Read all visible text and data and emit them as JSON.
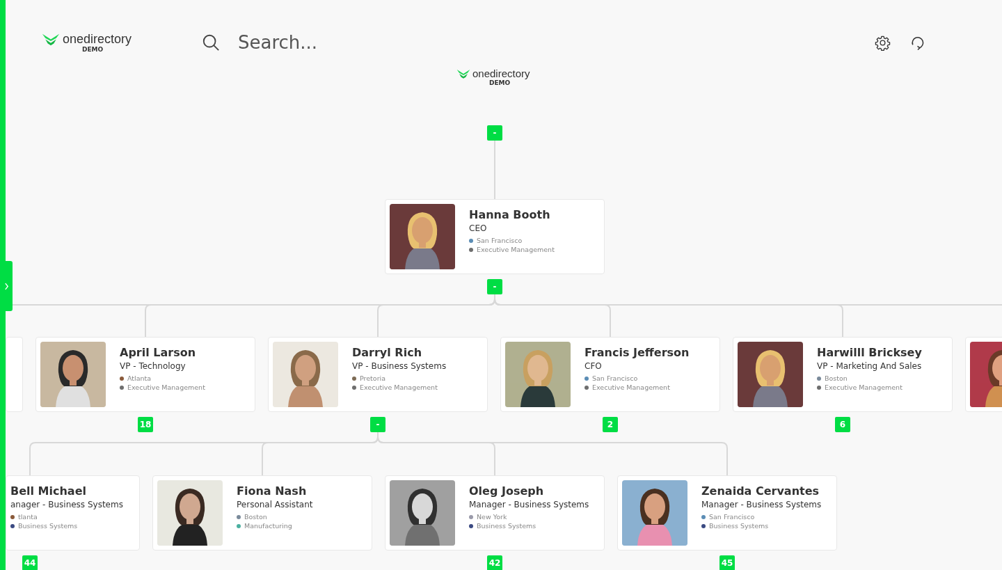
{
  "header": {
    "logo": {
      "name": "onedirectory",
      "tag": "DEMO"
    },
    "search": {
      "placeholder": "Search..."
    }
  },
  "chart_logo": {
    "name": "onedirectory",
    "tag": "DEMO"
  },
  "org_chart": {
    "root": {
      "kind": "full",
      "name": "Hanna Booth",
      "title": "CEO",
      "parent_toggle": "-",
      "toggle": "-",
      "location": {
        "text": "San Francisco",
        "color": "#5b8db5"
      },
      "department": {
        "text": "Executive Management",
        "color": "#6e6e6e"
      },
      "children": [
        {
          "kind": "stub"
        },
        {
          "kind": "full",
          "name": "April Larson",
          "title": "VP - Technology",
          "toggle": "18",
          "location": {
            "text": "Atlanta",
            "color": "#8a5a3a"
          },
          "department": {
            "text": "Executive Management",
            "color": "#6e6e6e"
          }
        },
        {
          "kind": "full",
          "name": "Darryl Rich",
          "title": "VP - Business Systems",
          "toggle": "-",
          "location": {
            "text": "Pretoria",
            "color": "#7d6b55"
          },
          "department": {
            "text": "Executive Management",
            "color": "#6e6e6e"
          },
          "children": [
            {
              "kind": "full",
              "name": "Bell Michael",
              "title": "anager - Business Systems",
              "toggle": "44",
              "location": {
                "text": "tlanta",
                "color": "#8a5a3a"
              },
              "department": {
                "text": "Business Systems",
                "color": "#3b4a82"
              }
            },
            {
              "kind": "full",
              "name": "Fiona Nash",
              "title": "Personal Assistant",
              "location": {
                "text": "Boston",
                "color": "#7a8a9a"
              },
              "department": {
                "text": "Manufacturing",
                "color": "#4bb0a0"
              }
            },
            {
              "kind": "full",
              "name": "Oleg Joseph",
              "title": "Manager - Business Systems",
              "toggle": "42",
              "location": {
                "text": "New York",
                "color": "#9a9aaa"
              },
              "department": {
                "text": "Business Systems",
                "color": "#3b4a82"
              }
            },
            {
              "kind": "full",
              "name": "Zenaida Cervantes",
              "title": "Manager - Business Systems",
              "toggle": "45",
              "location": {
                "text": "San Francisco",
                "color": "#5b8db5"
              },
              "department": {
                "text": "Business Systems",
                "color": "#3b4a82"
              }
            }
          ]
        },
        {
          "kind": "full",
          "name": "Francis Jefferson",
          "title": "CFO",
          "toggle": "2",
          "location": {
            "text": "San Francisco",
            "color": "#5b8db5"
          },
          "department": {
            "text": "Executive Management",
            "color": "#6e6e6e"
          }
        },
        {
          "kind": "full",
          "name": "Harwilll Bricksey",
          "title": "VP - Marketing And Sales",
          "toggle": "6",
          "location": {
            "text": "Boston",
            "color": "#7a8a9a"
          },
          "department": {
            "text": "Executive Management",
            "color": "#6e6e6e"
          }
        },
        {
          "kind": "photo_only"
        }
      ]
    }
  }
}
